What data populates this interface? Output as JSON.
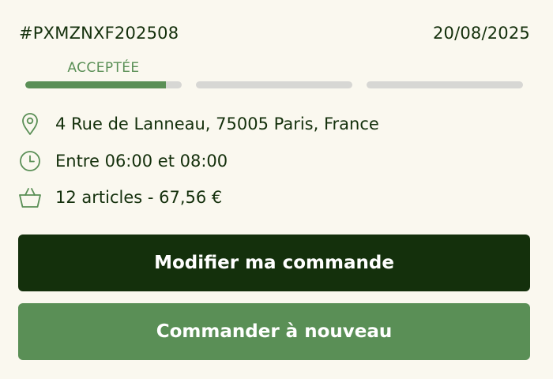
{
  "order": {
    "reference": "#PXMZNXF202508",
    "date": "20/08/2025"
  },
  "status": {
    "label": "ACCEPTÉE",
    "steps_total": 3,
    "current_step_progress": 0.9,
    "accent_color": "#5a8f56",
    "inactive_color": "#d7d7d4"
  },
  "details": {
    "address": "4 Rue de Lanneau, 75005 Paris, France",
    "time_slot": "Entre 06:00 et 08:00",
    "summary": "12 articles - 67,56 €"
  },
  "icons": {
    "address": "location-pin-icon",
    "time_slot": "clock-icon",
    "summary": "basket-icon"
  },
  "actions": {
    "modify_label": "Modifier ma commande",
    "reorder_label": "Commander à nouveau"
  },
  "colors": {
    "background": "#faf8ef",
    "text": "#14300c",
    "primary_button": "#14300c",
    "secondary_button": "#5a8f56"
  }
}
